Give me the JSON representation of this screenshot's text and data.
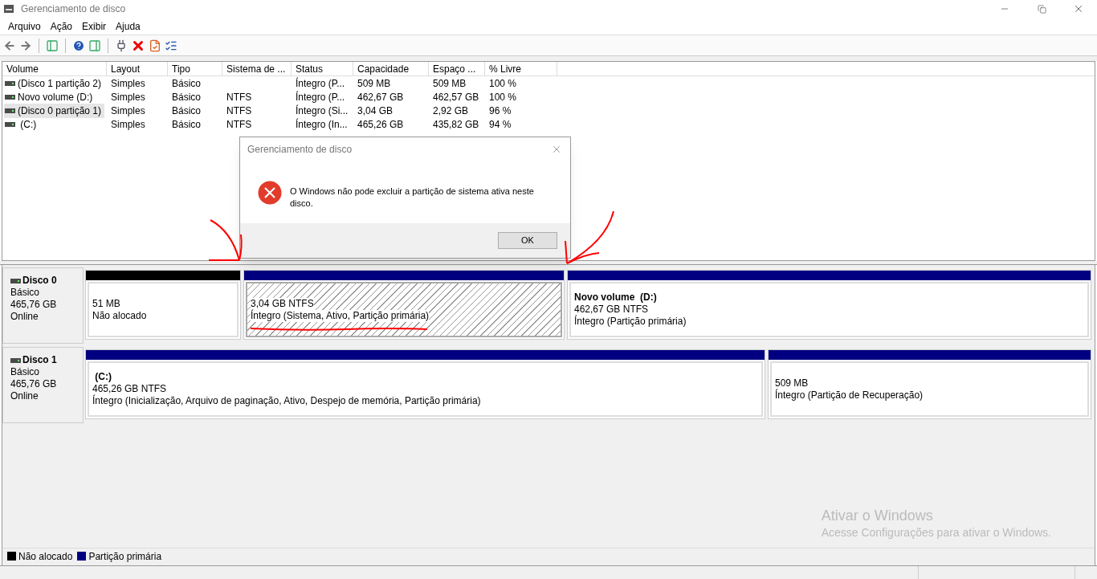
{
  "window": {
    "title": "Gerenciamento de disco"
  },
  "menu": [
    "Arquivo",
    "Ação",
    "Exibir",
    "Ajuda"
  ],
  "table": {
    "columns": [
      "Volume",
      "Layout",
      "Tipo",
      "Sistema de ...",
      "Status",
      "Capacidade",
      "Espaço ...",
      "% Livre"
    ],
    "rows": [
      {
        "selected": false,
        "cells": [
          "(Disco 1 partição 2)",
          "Simples",
          "Básico",
          "",
          "Íntegro (P...",
          "509 MB",
          "509 MB",
          "100 %"
        ]
      },
      {
        "selected": false,
        "cells": [
          "Novo volume (D:)",
          "Simples",
          "Básico",
          "NTFS",
          "Íntegro (P...",
          "462,67 GB",
          "462,57 GB",
          "100 %"
        ]
      },
      {
        "selected": true,
        "cells": [
          "(Disco 0 partição 1)",
          "Simples",
          "Básico",
          "NTFS",
          "Íntegro (Si...",
          "3,04 GB",
          "2,92 GB",
          "96 %"
        ]
      },
      {
        "selected": false,
        "cells": [
          " (C:)",
          "Simples",
          "Básico",
          "NTFS",
          "Íntegro (In...",
          "465,26 GB",
          "435,82 GB",
          "94 %"
        ]
      }
    ]
  },
  "disks": [
    {
      "name": "Disco 0",
      "type": "Básico",
      "size": "465,76 GB",
      "status": "Online",
      "partitions": [
        {
          "kind": "unallocated",
          "selected": false,
          "lines": [
            "51 MB",
            "Não alocado"
          ]
        },
        {
          "kind": "primary",
          "selected": true,
          "lines": [
            "3,04 GB NTFS",
            "Íntegro (Sistema, Ativo, Partição primária)"
          ]
        },
        {
          "kind": "primary",
          "selected": false,
          "title": "Novo volume  (D:)",
          "lines": [
            "462,67 GB NTFS",
            "Íntegro (Partição primária)"
          ]
        }
      ]
    },
    {
      "name": "Disco 1",
      "type": "Básico",
      "size": "465,76 GB",
      "status": "Online",
      "partitions": [
        {
          "kind": "primary",
          "selected": false,
          "title": " (C:)",
          "lines": [
            "465,26 GB NTFS",
            "Íntegro (Inicialização, Arquivo de paginação, Ativo, Despejo de memória, Partição primária)"
          ]
        },
        {
          "kind": "primary",
          "selected": false,
          "lines": [
            "509 MB",
            "Íntegro (Partição de Recuperação)"
          ]
        }
      ]
    }
  ],
  "legend": [
    {
      "label": "Não alocado",
      "color": "#000000"
    },
    {
      "label": "Partição primária",
      "color": "#000080"
    }
  ],
  "activation": {
    "title": "Ativar o Windows",
    "subtitle": "Acesse Configurações para ativar o Windows."
  },
  "dialog": {
    "title": "Gerenciamento de disco",
    "message": "O Windows não pode excluir a partição de sistema ativa neste disco.",
    "button": "OK"
  }
}
